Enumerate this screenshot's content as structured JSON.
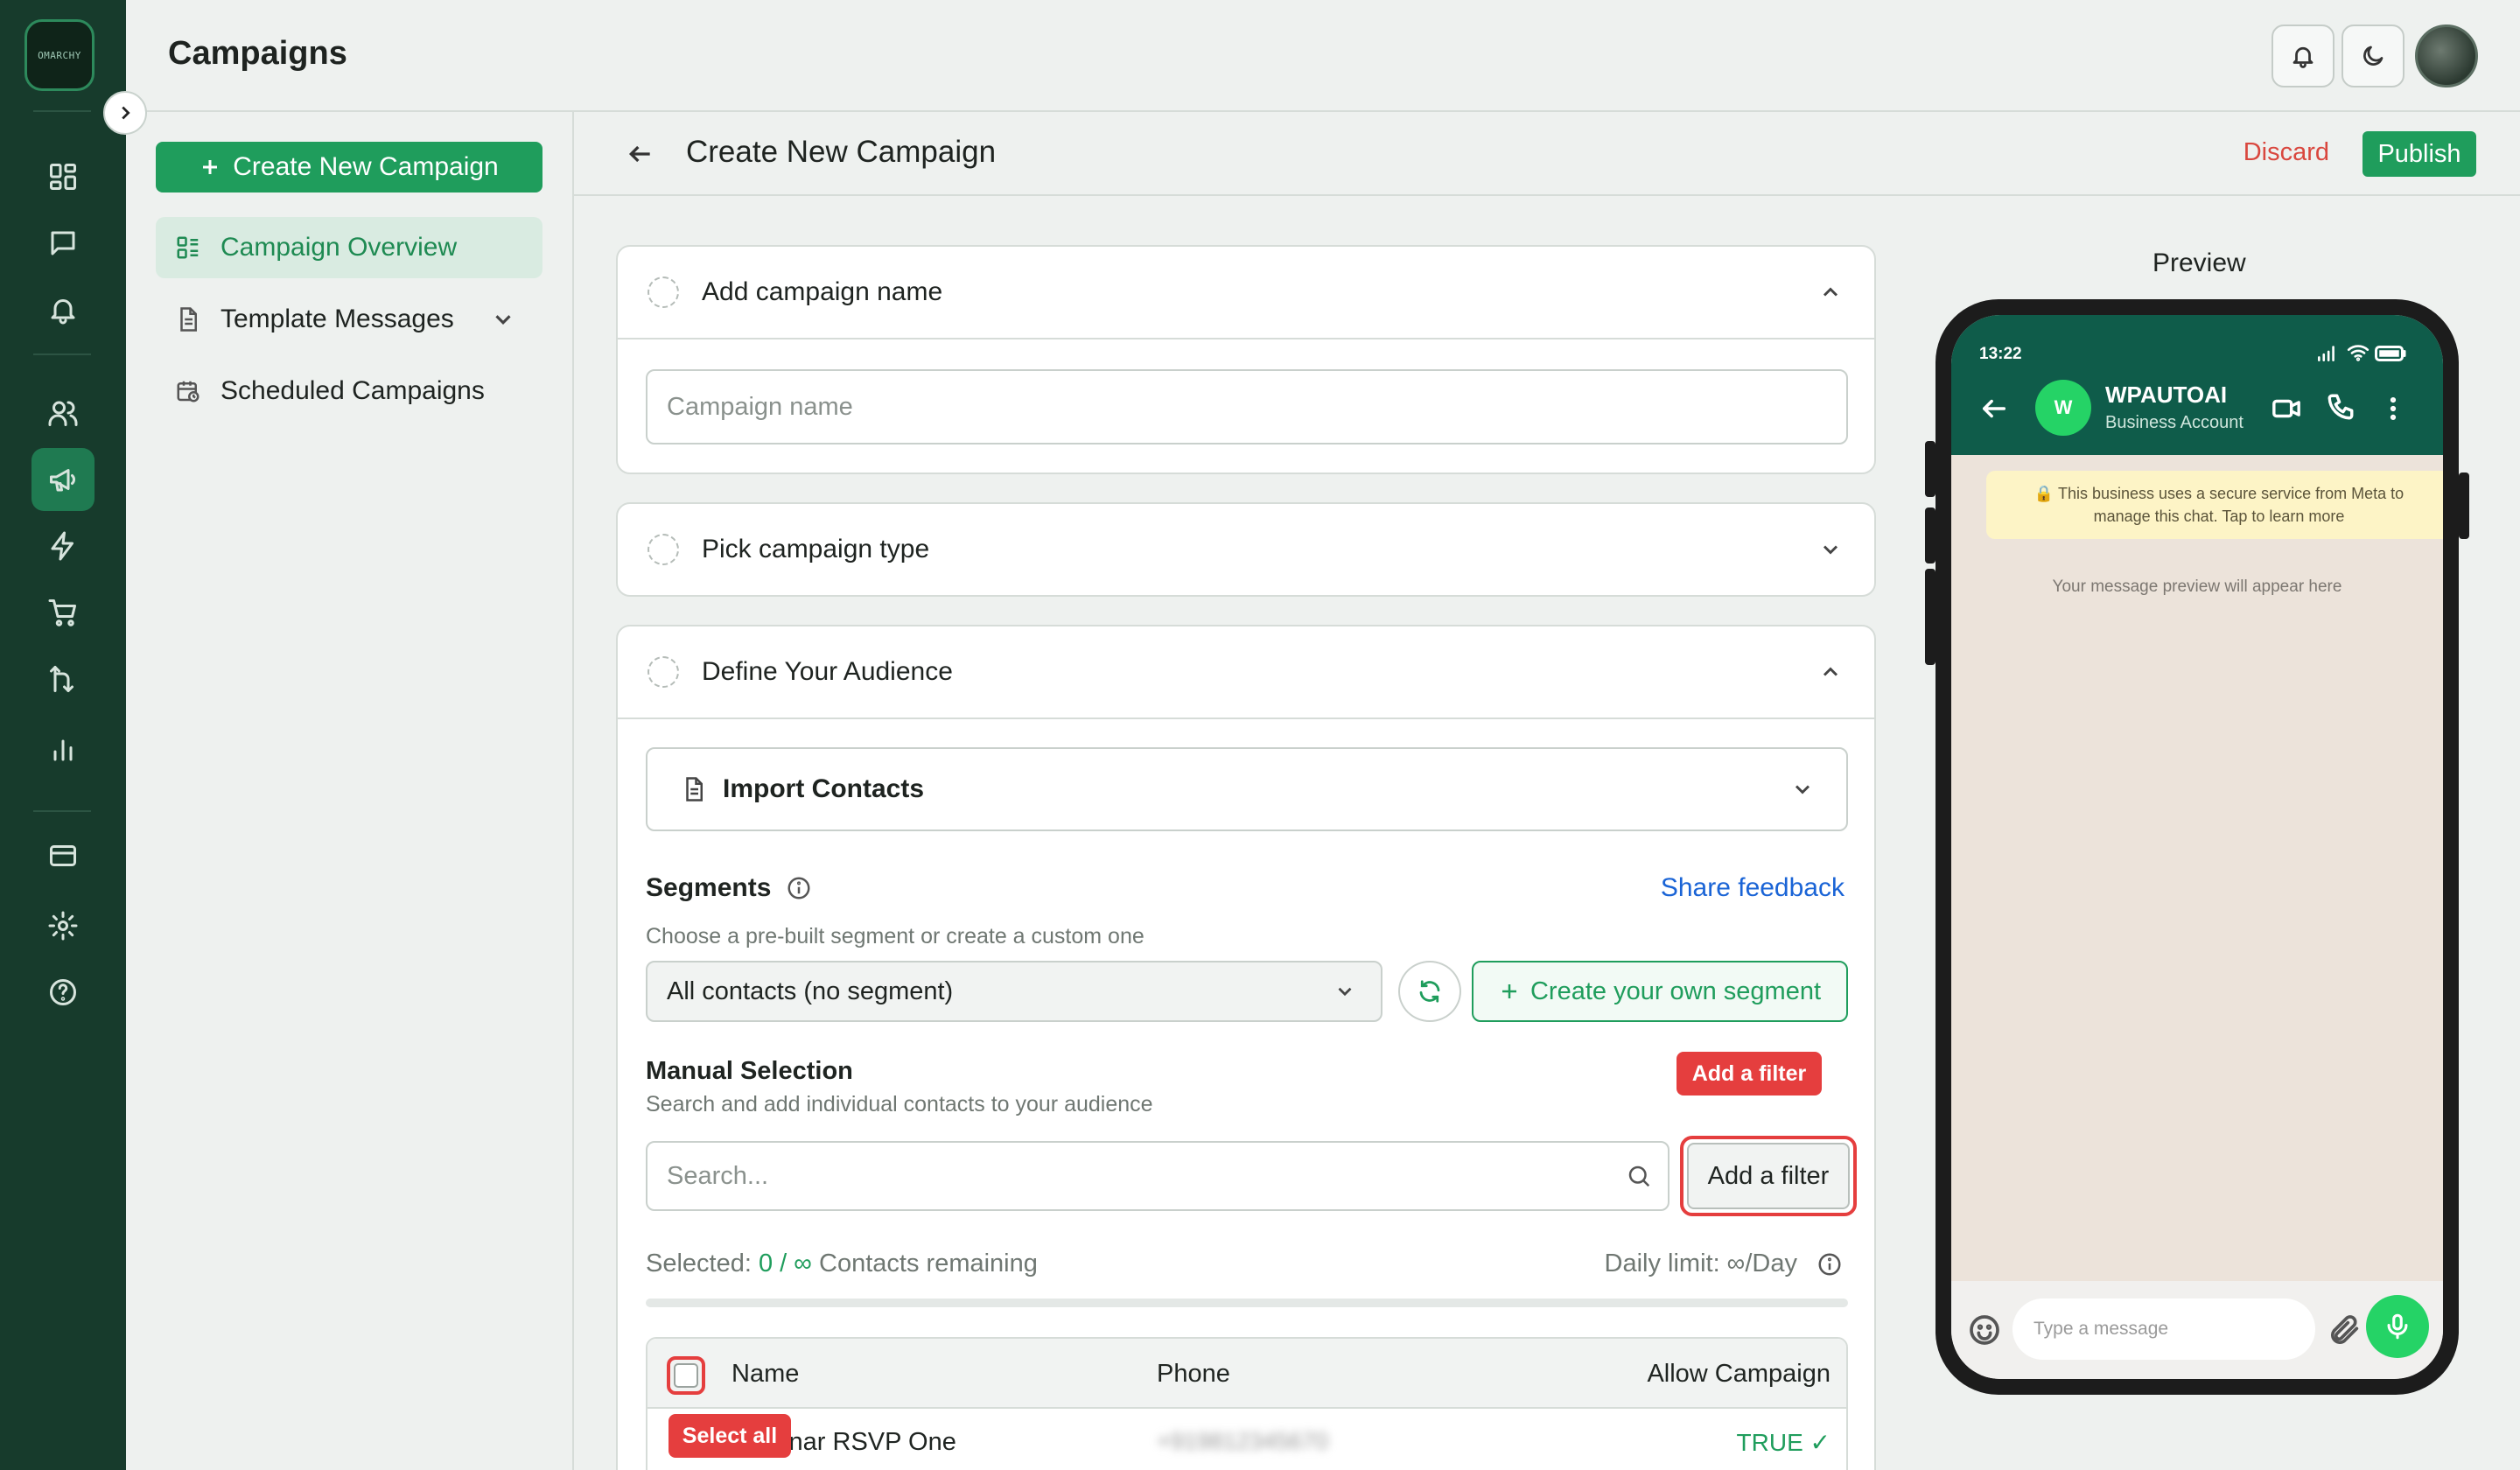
{
  "app": {
    "logo_text": "OMARCHY",
    "page_title": "Campaigns"
  },
  "rail": {
    "items": [
      "dashboard-icon",
      "chat-icon",
      "bell-icon",
      "users-icon",
      "megaphone-icon",
      "lightning-icon",
      "cart-icon",
      "workflow-icon",
      "bar-chart-icon",
      "card-icon",
      "gear-icon",
      "help-icon"
    ],
    "active": "megaphone-icon"
  },
  "subnav": {
    "create_label": "Create New Campaign",
    "items": [
      {
        "label": "Campaign Overview",
        "active": true
      },
      {
        "label": "Template Messages",
        "active": false
      },
      {
        "label": "Scheduled Campaigns",
        "active": false
      }
    ]
  },
  "main": {
    "title": "Create New Campaign",
    "discard": "Discard",
    "publish": "Publish"
  },
  "step_name": {
    "label": "Add campaign name",
    "placeholder": "Campaign name"
  },
  "step_type": {
    "label": "Pick campaign type"
  },
  "step_audience": {
    "label": "Define Your Audience",
    "import_label": "Import Contacts",
    "segments_label": "Segments",
    "share_feedback": "Share feedback",
    "segments_hint": "Choose a pre-built segment or create a custom one",
    "segment_selected": "All contacts (no segment)",
    "create_segment": "Create your own segment",
    "manual_title": "Manual Selection",
    "manual_hint": "Search and add individual contacts to your audience",
    "search_placeholder": "Search...",
    "add_filter": "Add a filter",
    "tooltip_filter": "Add a filter",
    "selected_prefix": "Selected:",
    "selected_value": "0 / ∞",
    "selected_suffix": "Contacts remaining",
    "daily_limit": "Daily limit: ∞/Day",
    "table": {
      "headers": [
        "Name",
        "Phone",
        "Allow Campaign"
      ],
      "rows": [
        {
          "name": "Webinar RSVP One",
          "phone": "+919812345670",
          "allow": "TRUE ✓"
        }
      ]
    },
    "tooltip_select_all": "Select all"
  },
  "preview": {
    "label": "Preview",
    "time": "13:22",
    "avatar_letter": "W",
    "business_name": "WPAUTOAI",
    "business_sub": "Business Account",
    "notice": "This business uses a secure service from Meta to manage this chat. Tap to learn more",
    "hint": "Your message preview will appear here",
    "message_placeholder": "Type a message"
  },
  "colors": {
    "brand_green": "#1f9d5c",
    "rail_bg": "#173b2c",
    "danger": "#e53e3e",
    "link_blue": "#1a64d6"
  }
}
